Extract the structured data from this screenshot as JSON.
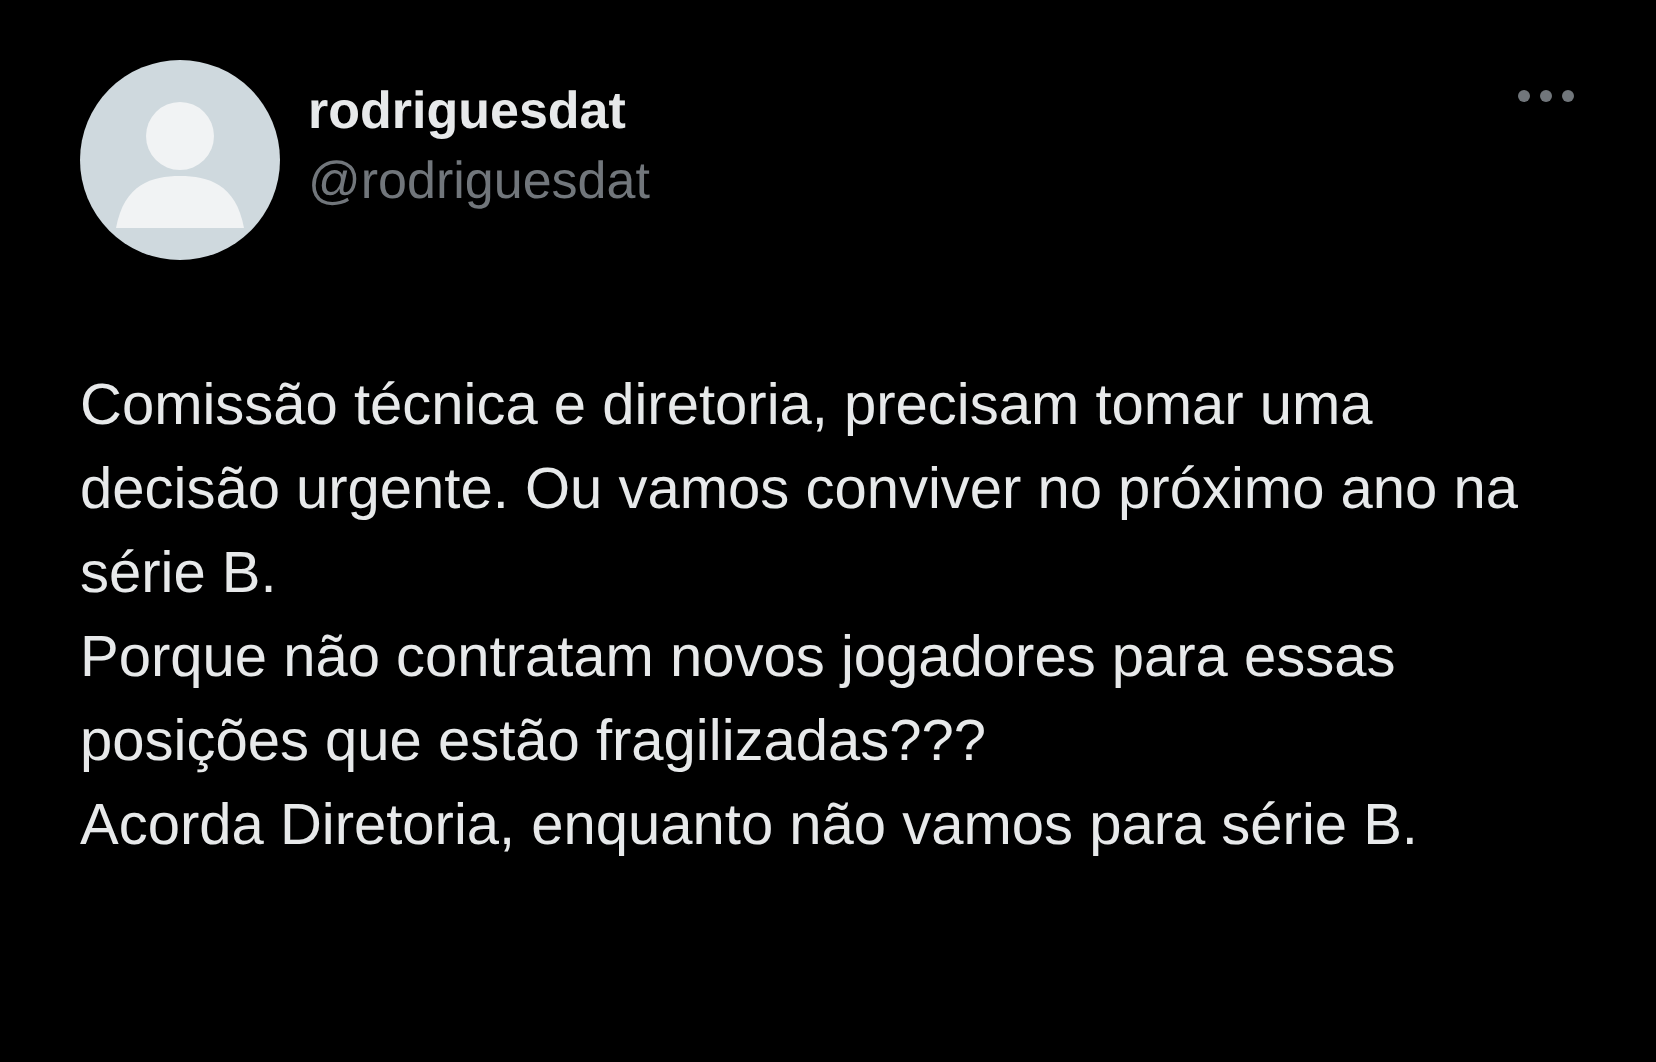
{
  "author": {
    "name": "rodriguesdat",
    "handle": "@rodriguesdat"
  },
  "paragraphs": [
    "Comissão técnica e diretoria, precisam tomar uma decisão urgente. Ou vamos conviver no próximo ano na série B.",
    "Porque não contratam novos jogadores para essas posições que estão fragilizadas???",
    "Acorda Diretoria, enquanto não vamos para série B."
  ]
}
